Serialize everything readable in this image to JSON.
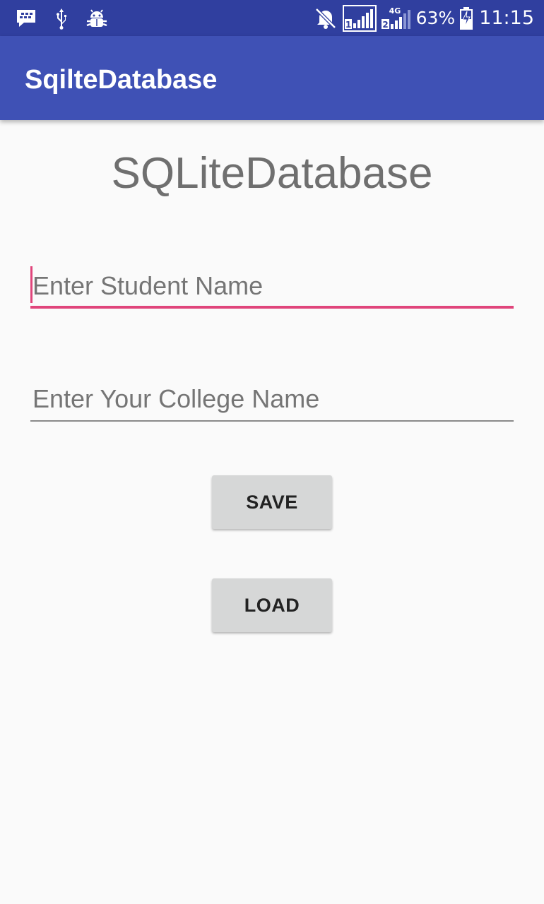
{
  "status_bar": {
    "battery_text": "63%",
    "time": "11:15",
    "network_label": "4G",
    "sim1_label": "1",
    "sim2_label": "2",
    "left_icons": [
      "bbm-chat-icon",
      "usb-icon",
      "android-debug-icon"
    ],
    "right_icons": [
      "mute-icon",
      "signal-sim1-icon",
      "signal-sim2-4g-icon",
      "battery-charging-icon"
    ]
  },
  "app_bar": {
    "title": "SqilteDatabase"
  },
  "main": {
    "heading": "SQLiteDatabase",
    "student_name_placeholder": "Enter Student Name",
    "student_name_value": "",
    "college_name_placeholder": "Enter Your College Name",
    "college_name_value": "",
    "save_label": "SAVE",
    "load_label": "LOAD"
  },
  "colors": {
    "status_bar": "#303f9f",
    "app_bar": "#3f51b5",
    "accent": "#e0457b",
    "background": "#fafafa",
    "button": "#d6d7d7"
  }
}
